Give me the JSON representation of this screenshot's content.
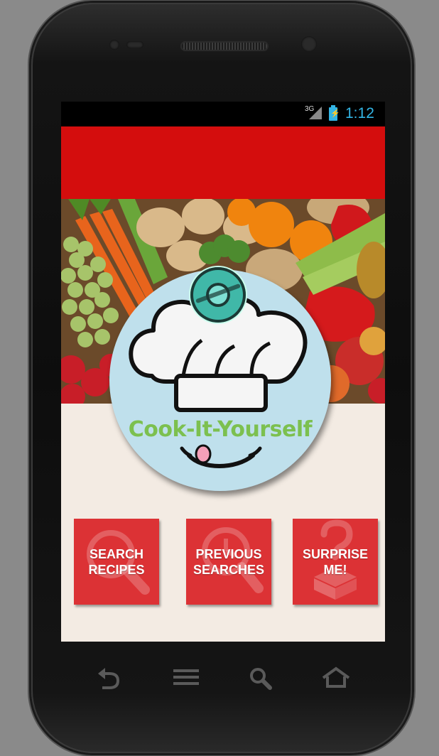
{
  "status_bar": {
    "network": "3G",
    "time": "1:12"
  },
  "app": {
    "logo_text": "Cook-It-Yourself"
  },
  "menu": {
    "search": {
      "label": "SEARCH\nRECIPES",
      "icon": "magnifier-icon"
    },
    "previous": {
      "label": "PREVIOUS\nSEARCHES",
      "icon": "clock-magnifier-icon"
    },
    "surprise": {
      "label": "SURPRISE\nME!",
      "icon": "question-box-icon"
    }
  },
  "nav_buttons": [
    "back-icon",
    "menu-icon",
    "search-icon",
    "home-icon"
  ],
  "colors": {
    "action_bar": "#d40d0d",
    "tile": "#dc3235",
    "screen_bg": "#f3ebe3",
    "status_accent": "#33b5e5",
    "logo_text": "#7cc04f"
  }
}
